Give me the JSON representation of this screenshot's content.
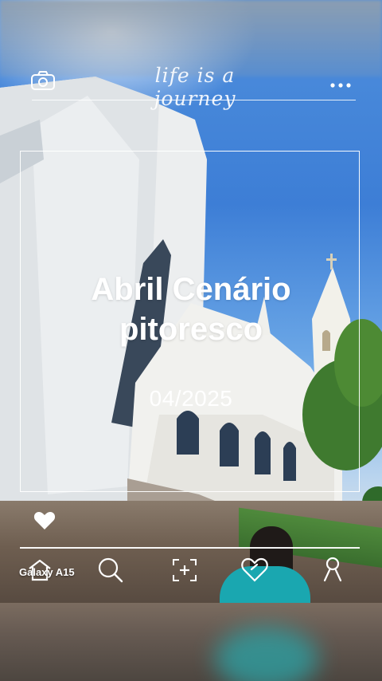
{
  "header": {
    "script_title": "life is a journey",
    "camera_icon": "camera-icon",
    "more_icon": "more-dots-icon"
  },
  "card": {
    "title": "Abril Cenário pitoresco",
    "date": "04/2025"
  },
  "bottom_bar": {
    "device_label": "Galaxy A15",
    "icons": [
      "heart-icon",
      "home-icon",
      "search-icon",
      "add-icon",
      "likes-icon",
      "profile-icon"
    ]
  },
  "colors": {
    "overlay": "#ffffff",
    "sky": "#3d7ed6",
    "church": "#eeeeee"
  }
}
